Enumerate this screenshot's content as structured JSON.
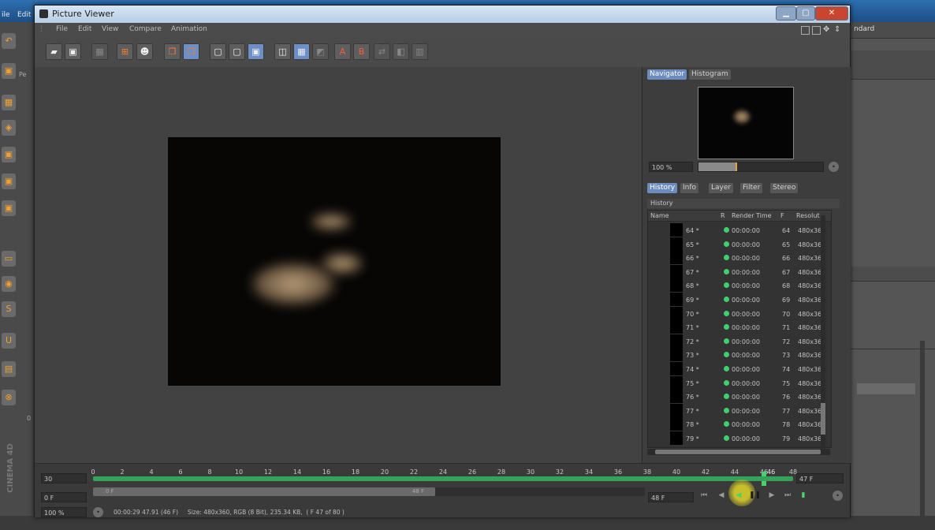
{
  "background_app": {
    "menu_items": [
      "ile",
      "Edit"
    ],
    "right_field": "ndard",
    "side_label": "CINEMA 4D",
    "partial_labels": [
      "Pe",
      "0"
    ]
  },
  "window": {
    "title": "Picture Viewer",
    "title_color": "#d7e6f5",
    "close_color": "#c9452f"
  },
  "menu": [
    "File",
    "Edit",
    "View",
    "Compare",
    "Animation"
  ],
  "toolbar_icons": [
    "open-icon",
    "save-icon",
    "grid-icon",
    "export-icon",
    "user-icon",
    "copy-icon",
    "copy-active-icon",
    "rect-region-icon",
    "region-icon",
    "region-alt-icon",
    "compare-ab-icon",
    "grid-view-icon",
    "ab-icon",
    "set-a-icon",
    "set-b-icon",
    "swap-icon",
    "split-icon",
    "diff-icon"
  ],
  "navigator": {
    "tabs": [
      "Navigator",
      "Histogram"
    ],
    "zoom": "100 %",
    "zoom_fill": 0.3
  },
  "history": {
    "tabs": [
      "History",
      "Info",
      "Layer",
      "Filter",
      "Stereo"
    ],
    "section_title": "History",
    "columns": [
      "Name",
      "R",
      "Render Time",
      "F",
      "Resolut"
    ],
    "rows": [
      {
        "name": "64 *",
        "time": "00:00:00",
        "frame": "64",
        "res": "480x36"
      },
      {
        "name": "65 *",
        "time": "00:00:00",
        "frame": "65",
        "res": "480x36"
      },
      {
        "name": "66 *",
        "time": "00:00:00",
        "frame": "66",
        "res": "480x36"
      },
      {
        "name": "67 *",
        "time": "00:00:00",
        "frame": "67",
        "res": "480x36"
      },
      {
        "name": "68 *",
        "time": "00:00:00",
        "frame": "68",
        "res": "480x36"
      },
      {
        "name": "69 *",
        "time": "00:00:00",
        "frame": "69",
        "res": "480x36"
      },
      {
        "name": "70 *",
        "time": "00:00:00",
        "frame": "70",
        "res": "480x36"
      },
      {
        "name": "71 *",
        "time": "00:00:00",
        "frame": "71",
        "res": "480x36"
      },
      {
        "name": "72 *",
        "time": "00:00:00",
        "frame": "72",
        "res": "480x36"
      },
      {
        "name": "73 *",
        "time": "00:00:00",
        "frame": "73",
        "res": "480x36"
      },
      {
        "name": "74 *",
        "time": "00:00:00",
        "frame": "74",
        "res": "480x36"
      },
      {
        "name": "75 *",
        "time": "00:00:00",
        "frame": "75",
        "res": "480x36"
      },
      {
        "name": "76 *",
        "time": "00:00:00",
        "frame": "76",
        "res": "480x36"
      },
      {
        "name": "77 *",
        "time": "00:00:00",
        "frame": "77",
        "res": "480x36"
      },
      {
        "name": "78 *",
        "time": "00:00:00",
        "frame": "78",
        "res": "480x36"
      },
      {
        "name": "79 *",
        "time": "00:00:00",
        "frame": "79",
        "res": "480x36"
      }
    ]
  },
  "timeline": {
    "fps": "30",
    "ticks": [
      "0",
      "2",
      "4",
      "6",
      "8",
      "10",
      "12",
      "14",
      "16",
      "18",
      "20",
      "22",
      "24",
      "26",
      "28",
      "30",
      "32",
      "34",
      "36",
      "38",
      "40",
      "42",
      "44",
      "46",
      "48"
    ],
    "current_frame_label": "46",
    "current_frame": 46,
    "max_frame": 48,
    "frame_display": "47 F",
    "start_field": "0 F",
    "range_start": "0 F",
    "range_end": "48 F",
    "end_field": "48 F",
    "zoom": "100 %",
    "status": "00:00:29 47.91 (46 F)     Size: 480x360, RGB (8 Bit), 235.34 KB,  ( F 47 of 80 )"
  }
}
